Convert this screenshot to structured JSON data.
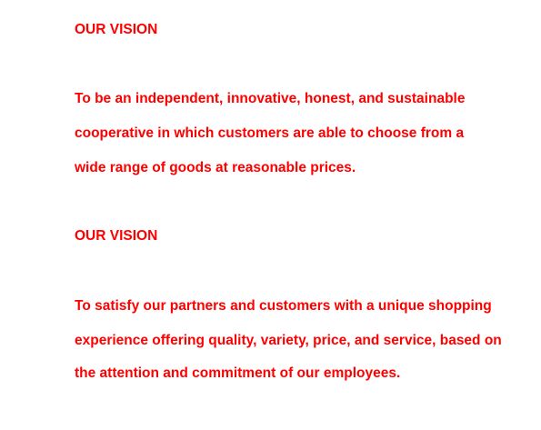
{
  "section1": {
    "heading": "OUR VISION",
    "lines": [
      "To be an independent, innovative, honest, and sustainable",
      "cooperative in which customers are able to choose from a",
      "wide range of goods at reasonable prices."
    ]
  },
  "section2": {
    "heading": "OUR VISION",
    "lines": [
      "To satisfy our partners and customers with a unique shopping",
      "experience offering quality, variety, price, and service, based on",
      " the attention and commitment of our employees."
    ]
  },
  "colors": {
    "text": "#ff0000",
    "background": "#ffffff"
  }
}
